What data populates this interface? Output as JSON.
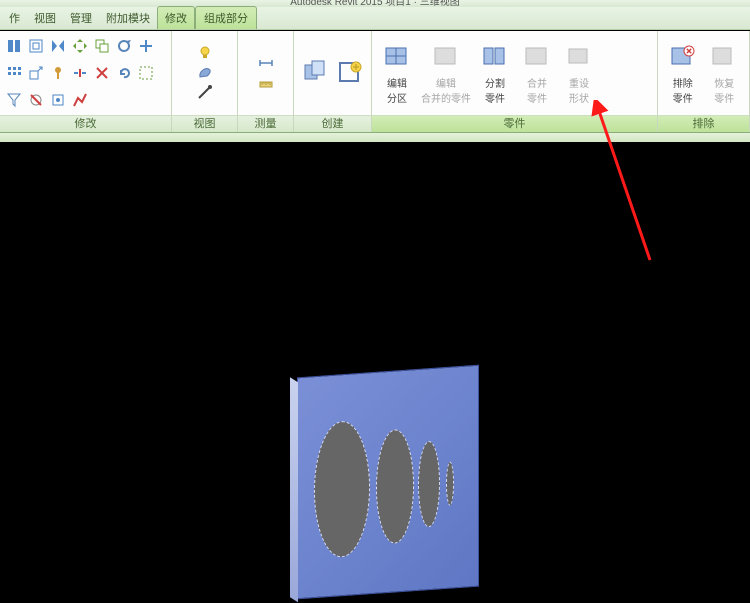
{
  "title_fragment": "Autodesk Revit 2015      项目1 · 三维视图",
  "tabs": {
    "t0": "作",
    "t1": "视图",
    "t2": "管理",
    "t3": "附加模块",
    "t4": "修改",
    "ctx": "组成部分"
  },
  "panels": {
    "modify": "修改",
    "view": "视图",
    "measure": "测量",
    "create": "创建",
    "parts": "零件",
    "exclude": "排除"
  },
  "parts_buttons": {
    "edit_division_l1": "编辑",
    "edit_division_l2": "分区",
    "edit_merged_l1": "编辑",
    "edit_merged_l2": "合并的零件",
    "split_l1": "分割",
    "split_l2": "零件",
    "merge_l1": "合并",
    "merge_l2": "零件",
    "reset_l1": "重设",
    "reset_l2": "形状",
    "exclude_l1": "排除",
    "exclude_l2": "零件",
    "restore_l1": "恢复",
    "restore_l2": "零件"
  }
}
